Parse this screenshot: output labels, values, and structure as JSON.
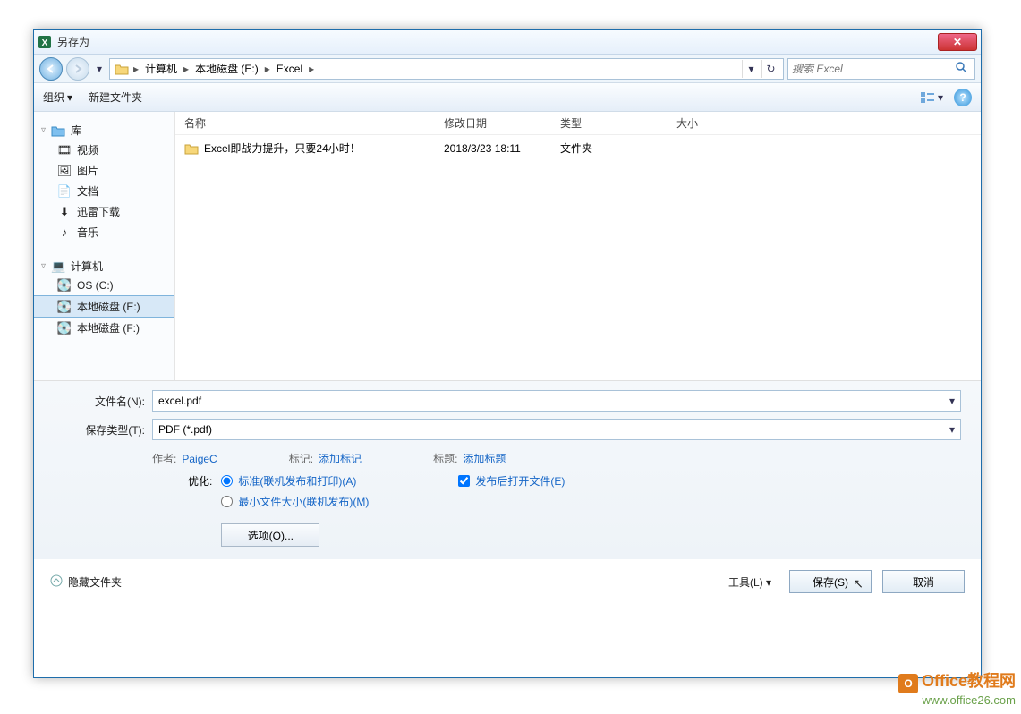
{
  "window": {
    "title": "另存为"
  },
  "nav": {
    "path": {
      "computer": "计算机",
      "drive": "本地磁盘 (E:)",
      "folder": "Excel"
    },
    "search_placeholder": "搜索 Excel"
  },
  "toolbar": {
    "organize": "组织",
    "newfolder": "新建文件夹"
  },
  "sidebar": {
    "libraries": {
      "label": "库",
      "videos": "视频",
      "pictures": "图片",
      "documents": "文档",
      "xunlei": "迅雷下载",
      "music": "音乐"
    },
    "computer": {
      "label": "计算机",
      "osc": "OS (C:)",
      "de": "本地磁盘 (E:)",
      "df": "本地磁盘 (F:)"
    }
  },
  "list": {
    "headers": {
      "name": "名称",
      "date": "修改日期",
      "type": "类型",
      "size": "大小"
    },
    "rows": [
      {
        "name": "Excel即战力提升，只要24小时！",
        "date": "2018/3/23 18:11",
        "type": "文件夹",
        "size": ""
      }
    ]
  },
  "form": {
    "filename_label": "文件名(N):",
    "filename_value": "excel.pdf",
    "savetype_label": "保存类型(T):",
    "savetype_value": "PDF (*.pdf)",
    "author_label": "作者:",
    "author_value": "PaigeC",
    "tags_label": "标记:",
    "tags_value": "添加标记",
    "title_label": "标题:",
    "title_value": "添加标题",
    "optimize_label": "优化:",
    "opt_standard": "标准(联机发布和打印)(A)",
    "opt_minsize": "最小文件大小(联机发布)(M)",
    "open_after": "发布后打开文件(E)",
    "options_btn": "选项(O)..."
  },
  "footer": {
    "hide": "隐藏文件夹",
    "tools": "工具(L)",
    "save": "保存(S)",
    "cancel": "取消"
  },
  "watermark": {
    "line1": "Office教程网",
    "line2": "www.office26.com"
  }
}
